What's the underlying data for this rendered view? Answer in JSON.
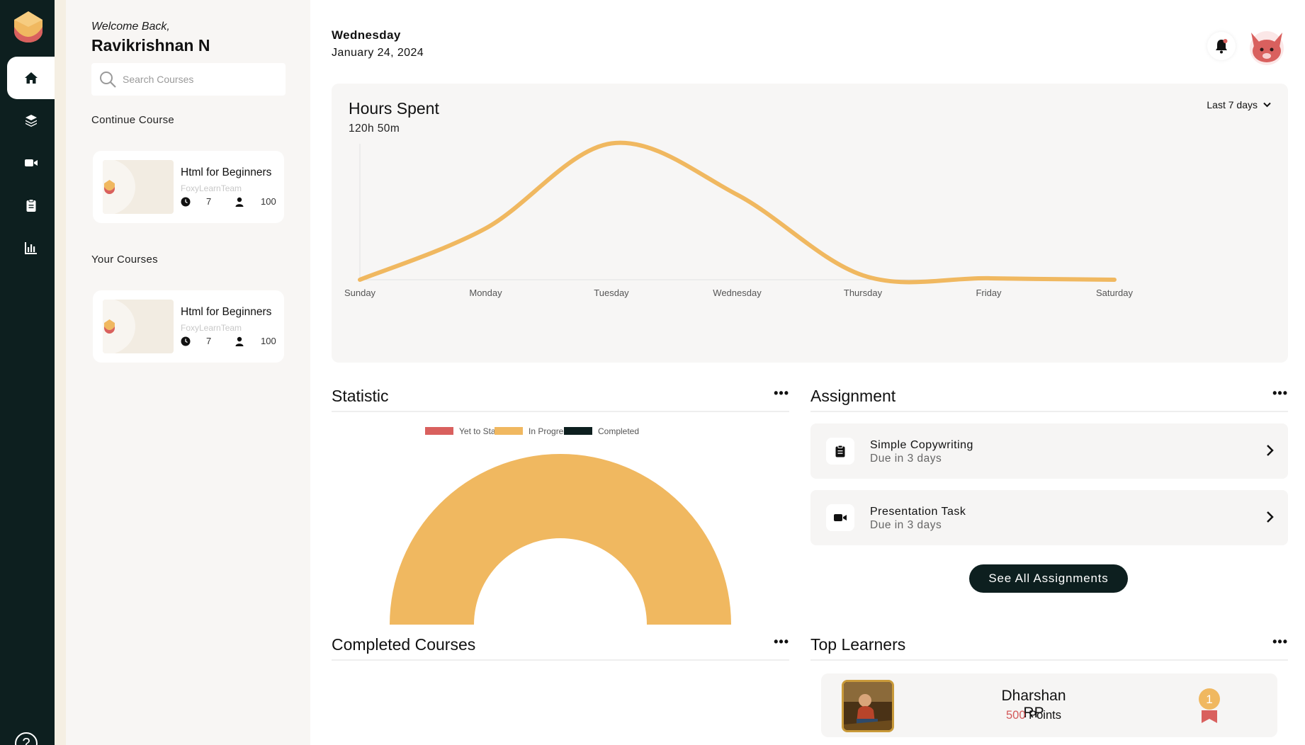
{
  "sidebar": {
    "nav": [
      {
        "name": "home",
        "icon": "home-icon",
        "active": true
      },
      {
        "name": "courses",
        "icon": "layers-icon"
      },
      {
        "name": "videos",
        "icon": "video-icon"
      },
      {
        "name": "assignments",
        "icon": "clipboard-icon"
      },
      {
        "name": "analytics",
        "icon": "bar-chart-icon"
      }
    ],
    "help_label": "?"
  },
  "side_panel": {
    "welcome": "Welcome Back,",
    "username": "Ravikrishnan N",
    "search_placeholder": "Search Courses",
    "continue_label": "Continue Course",
    "your_courses_label": "Your Courses",
    "continue_course": {
      "title": "Html for Beginners",
      "author": "FoxyLearnTeam",
      "lessons": "7",
      "students": "100"
    },
    "your_course": {
      "title": "Html for Beginners",
      "author": "FoxyLearnTeam",
      "lessons": "7",
      "students": "100"
    }
  },
  "header": {
    "day": "Wednesday",
    "date": "January 24, 2024"
  },
  "hours": {
    "title": "Hours Spent",
    "total": "120h 50m",
    "range": "Last 7 days"
  },
  "chart_data": [
    {
      "type": "line",
      "x": [
        "Sunday",
        "Monday",
        "Tuesday",
        "Wednesday",
        "Thursday",
        "Friday",
        "Saturday"
      ],
      "series": [
        {
          "values": [
            0,
            3.5,
            9.3,
            5.8,
            0.3,
            0.1,
            0
          ]
        }
      ],
      "ylim": [
        0,
        10
      ],
      "grid": false,
      "color": "#f0b860"
    },
    {
      "type": "pie",
      "variant": "half-donut",
      "legend": [
        "Yet to Start",
        "In Progress",
        "Completed"
      ],
      "colors": [
        "#d9605e",
        "#f0b860",
        "#0d1f1f"
      ],
      "values": [
        0,
        1,
        0
      ],
      "legend_position": "top"
    }
  ],
  "statistic": {
    "title": "Statistic",
    "menu": "•••"
  },
  "assignment": {
    "title": "Assignment",
    "menu": "•••",
    "items": [
      {
        "title": "Simple Copywriting",
        "due": "Due in 3 days",
        "icon": "clipboard-icon"
      },
      {
        "title": "Presentation Task",
        "due": "Due in 3 days",
        "icon": "video-icon"
      }
    ],
    "see_all": "See All Assignments"
  },
  "completed": {
    "title": "Completed Courses",
    "menu": "•••"
  },
  "top_learners": {
    "title": "Top Learners",
    "menu": "•••",
    "learner": {
      "name": "Dharshan RP",
      "points": "500",
      "points_label": "Points",
      "rank": "1"
    }
  },
  "colors": {
    "dark": "#0d1f1f",
    "accent": "#f0b860",
    "red": "#d9605e",
    "cream": "#f5efe3"
  }
}
